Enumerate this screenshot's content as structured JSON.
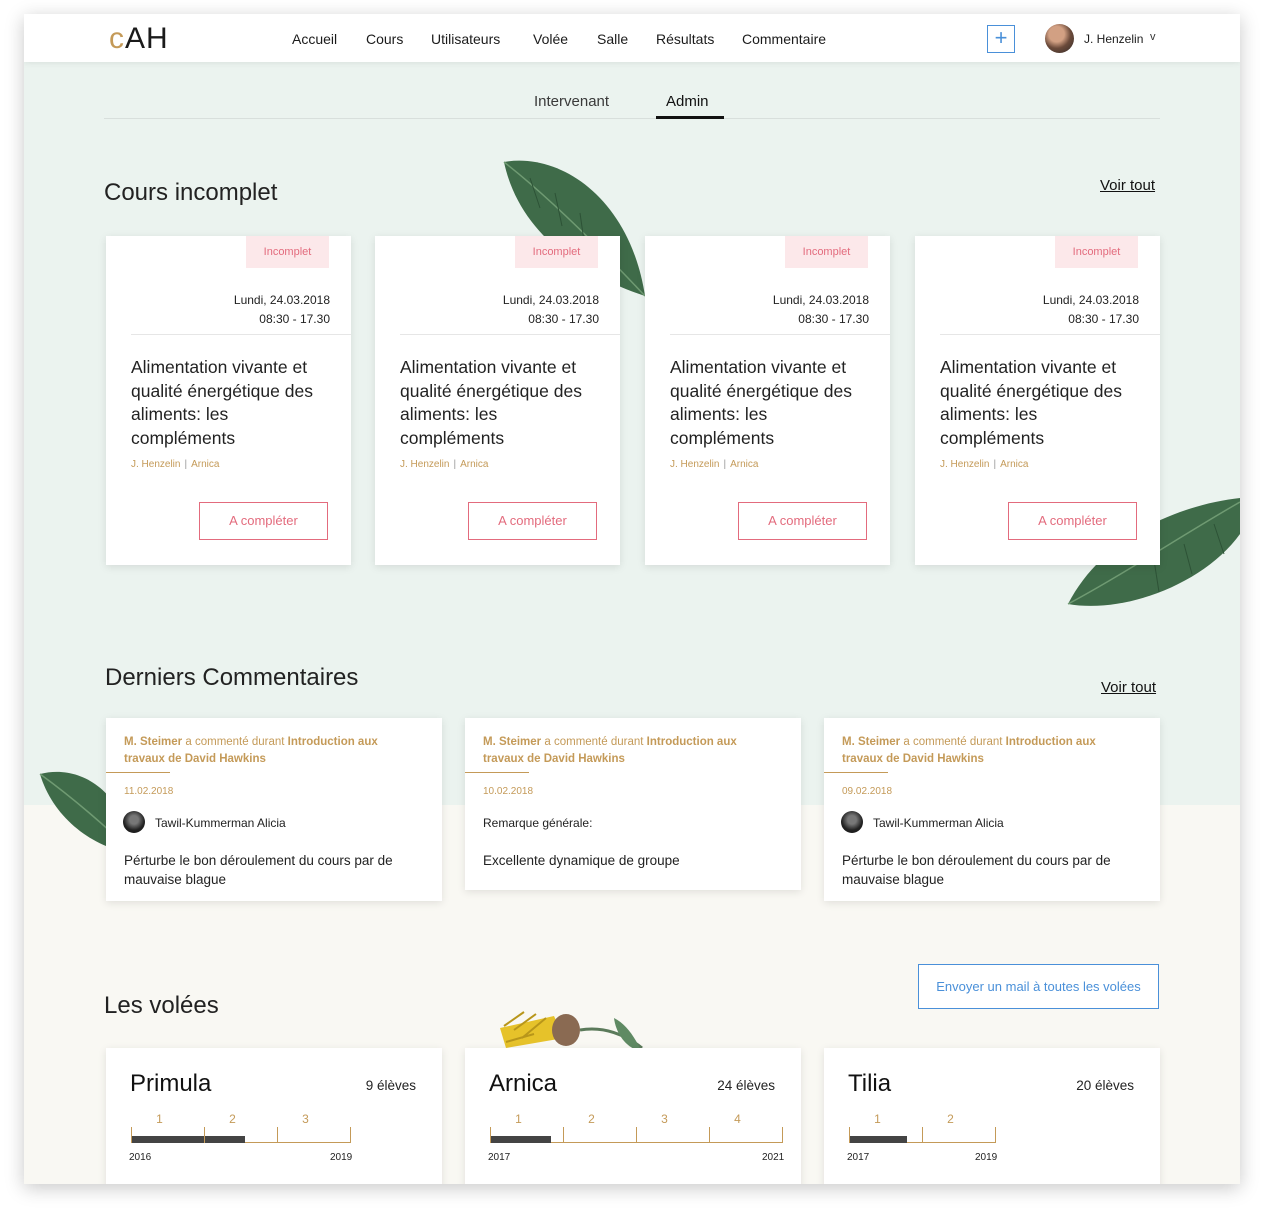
{
  "header": {
    "logo_c": "c",
    "logo_rest": "AH",
    "nav": [
      "Accueil",
      "Cours",
      "Utilisateurs",
      "Volée",
      "Salle",
      "Résultats",
      "Commentaire"
    ],
    "add_label": "+",
    "user_name": "J. Henzelin",
    "user_chevron": "v"
  },
  "tabs": [
    "Intervenant",
    "Admin"
  ],
  "active_tab": "Admin",
  "courses_section": {
    "title": "Cours incomplet",
    "view_all": "Voir tout",
    "cards": [
      {
        "badge": "Incomplet",
        "date": "Lundi, 24.03.2018",
        "time": "08:30 - 17.30",
        "title": "Alimentation vivante et qualité énergétique des aliments: les compléments",
        "author": "J. Henzelin",
        "group": "Arnica",
        "button": "A compléter"
      },
      {
        "badge": "Incomplet",
        "date": "Lundi, 24.03.2018",
        "time": "08:30 - 17.30",
        "title": "Alimentation vivante et qualité énergétique des aliments: les compléments",
        "author": "J. Henzelin",
        "group": "Arnica",
        "button": "A compléter"
      },
      {
        "badge": "Incomplet",
        "date": "Lundi, 24.03.2018",
        "time": "08:30 - 17.30",
        "title": "Alimentation vivante et qualité énergétique des aliments: les compléments",
        "author": "J. Henzelin",
        "group": "Arnica",
        "button": "A compléter"
      },
      {
        "badge": "Incomplet",
        "date": "Lundi, 24.03.2018",
        "time": "08:30 - 17.30",
        "title": "Alimentation vivante et qualité énergétique des aliments: les compléments",
        "author": "J. Henzelin",
        "group": "Arnica",
        "button": "A compléter"
      }
    ]
  },
  "comments_section": {
    "title": "Derniers Commentaires",
    "view_all": "Voir tout",
    "cards": [
      {
        "commenter": "M. Steimer",
        "verb": "a commenté durant",
        "course": "Introduction aux travaux de David Hawkins",
        "date": "11.02.2018",
        "subject": "Tawil-Kummerman Alicia",
        "text": "Pérturbe le bon déroulement du cours par de mauvaise blague"
      },
      {
        "commenter": "M. Steimer",
        "verb": "a commenté durant",
        "course": "Introduction aux travaux de David Hawkins",
        "date": "10.02.2018",
        "subject": "Remarque générale:",
        "text": "Excellente dynamique de groupe"
      },
      {
        "commenter": "M. Steimer",
        "verb": "a commenté durant",
        "course": "Introduction aux travaux de David Hawkins",
        "date": "09.02.2018",
        "subject": "Tawil-Kummerman Alicia",
        "text": "Pérturbe le bon déroulement du cours par de mauvaise blague"
      }
    ]
  },
  "volees_section": {
    "title": "Les volées",
    "mail_button": "Envoyer un mail à toutes les volées",
    "cards": [
      {
        "name": "Primula",
        "count": "9 élèves",
        "years": [
          "1",
          "2",
          "3"
        ],
        "start": "2016",
        "end": "2019",
        "progress": 0.52
      },
      {
        "name": "Arnica",
        "count": "24 élèves",
        "years": [
          "1",
          "2",
          "3",
          "4"
        ],
        "start": "2017",
        "end": "2021",
        "progress": 0.21
      },
      {
        "name": "Tilia",
        "count": "20 élèves",
        "years": [
          "1",
          "2"
        ],
        "start": "2017",
        "end": "2019",
        "progress": 0.4
      }
    ]
  },
  "colors": {
    "accent_gold": "#c49a58",
    "incomplete_red": "#e36b7d",
    "link_blue": "#4a90d9",
    "mint_bg": "#ebf3ef",
    "cream_bg": "#f9f8f3"
  }
}
